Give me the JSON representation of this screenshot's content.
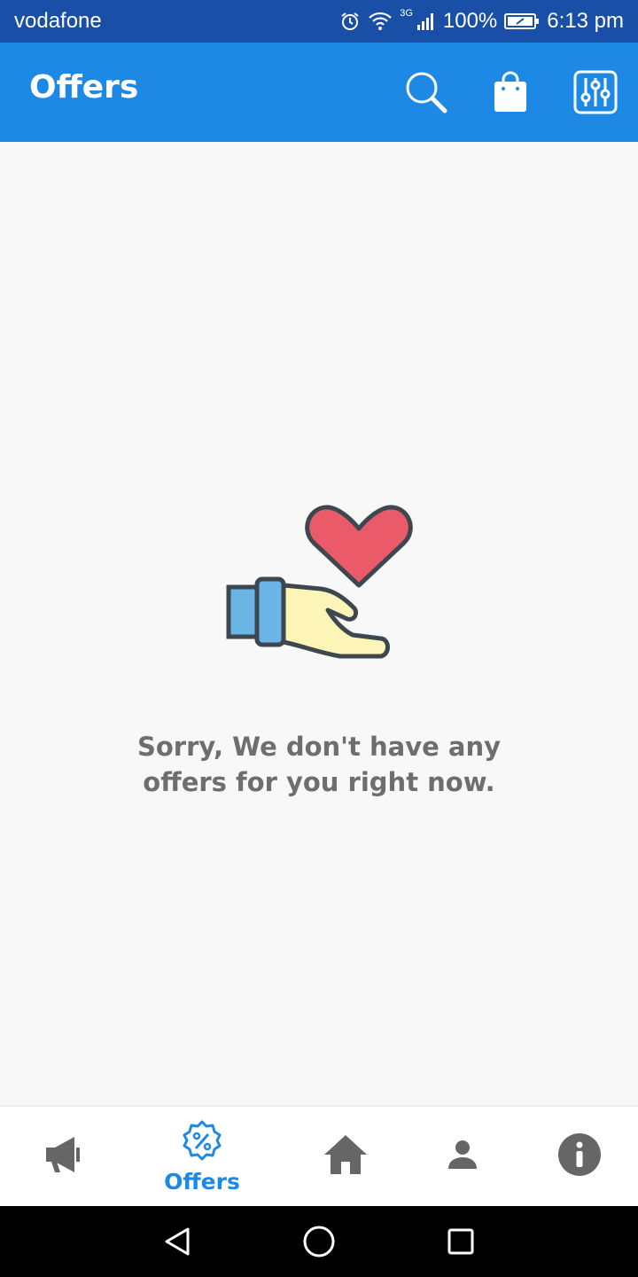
{
  "status_bar": {
    "carrier": "vodafone",
    "network": "3G",
    "battery": "100%",
    "time": "6:13 pm",
    "icons": [
      "alarm-icon",
      "wifi-icon",
      "signal-icon",
      "battery-icon"
    ]
  },
  "app_bar": {
    "title": "Offers",
    "actions": [
      "search-icon",
      "shopping-bag-icon",
      "filter-sliders-icon"
    ]
  },
  "empty_state": {
    "illustration": "hand-giving-heart-icon",
    "line1": "Sorry, We don't have any",
    "line2": "offers for you right now."
  },
  "bottom_nav": {
    "items": [
      {
        "icon": "megaphone-icon",
        "label": "",
        "active": false
      },
      {
        "icon": "percent-badge-icon",
        "label": "Offers",
        "active": true
      },
      {
        "icon": "home-icon",
        "label": "",
        "active": false
      },
      {
        "icon": "person-icon",
        "label": "",
        "active": false
      },
      {
        "icon": "info-icon",
        "label": "",
        "active": false
      }
    ]
  },
  "system_nav": {
    "buttons": [
      "back-icon",
      "home-circle-icon",
      "recents-icon"
    ]
  },
  "colors": {
    "status_bar": "#1a4fa8",
    "app_bar": "#1e88e5",
    "active": "#1e88e5",
    "inactive": "#666666",
    "message": "#6e6e6e",
    "heart": "#ea5a68",
    "sleeve": "#6ab4e6",
    "hand": "#fdf5b8"
  }
}
